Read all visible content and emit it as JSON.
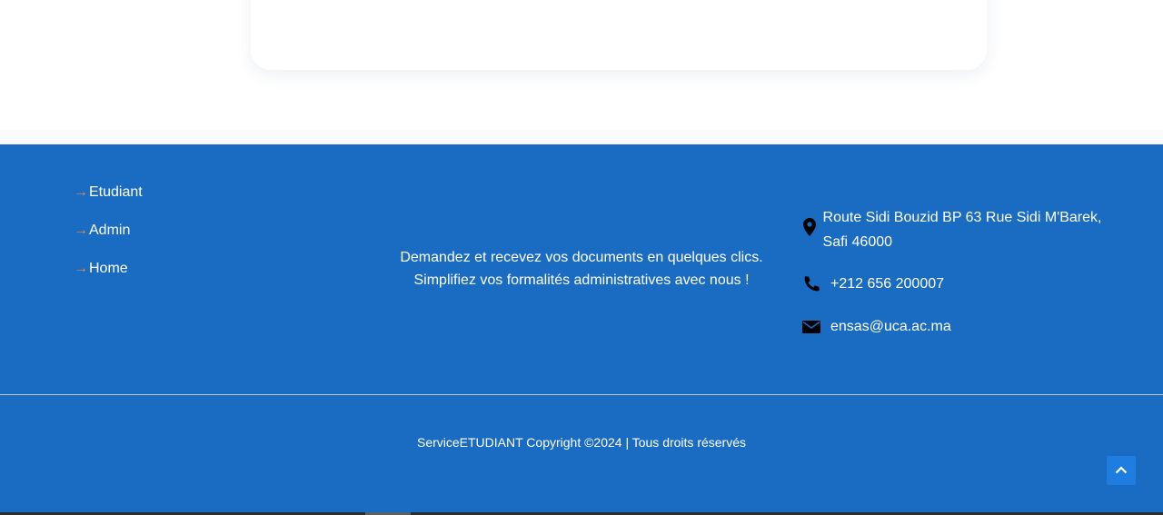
{
  "footer": {
    "links": [
      {
        "arrow": "→",
        "label": "Etudiant"
      },
      {
        "arrow": "→",
        "label": "Admin"
      },
      {
        "arrow": "→",
        "label": "Home"
      }
    ],
    "tagline": "Demandez et recevez vos documents en quelques clics. Simplifiez vos formalités administratives avec nous !",
    "contact": {
      "address": "Route Sidi Bouzid BP 63 Rue Sidi M'Barek, Safi 46000",
      "address_icon": "map-pin-icon",
      "phone": "+212 656 200007",
      "phone_icon": "phone-icon",
      "email": "ensas@uca.ac.ma",
      "email_icon": "envelope-icon"
    },
    "copyright": "ServiceETUDIANT Copyright ©2024 | Tous droits réservés",
    "back_to_top_icon": "chevron-up-icon"
  },
  "colors": {
    "footer_bg": "#1a6bc2",
    "arrow": "#f0893a",
    "back_to_top_bg": "#1f7de0"
  }
}
